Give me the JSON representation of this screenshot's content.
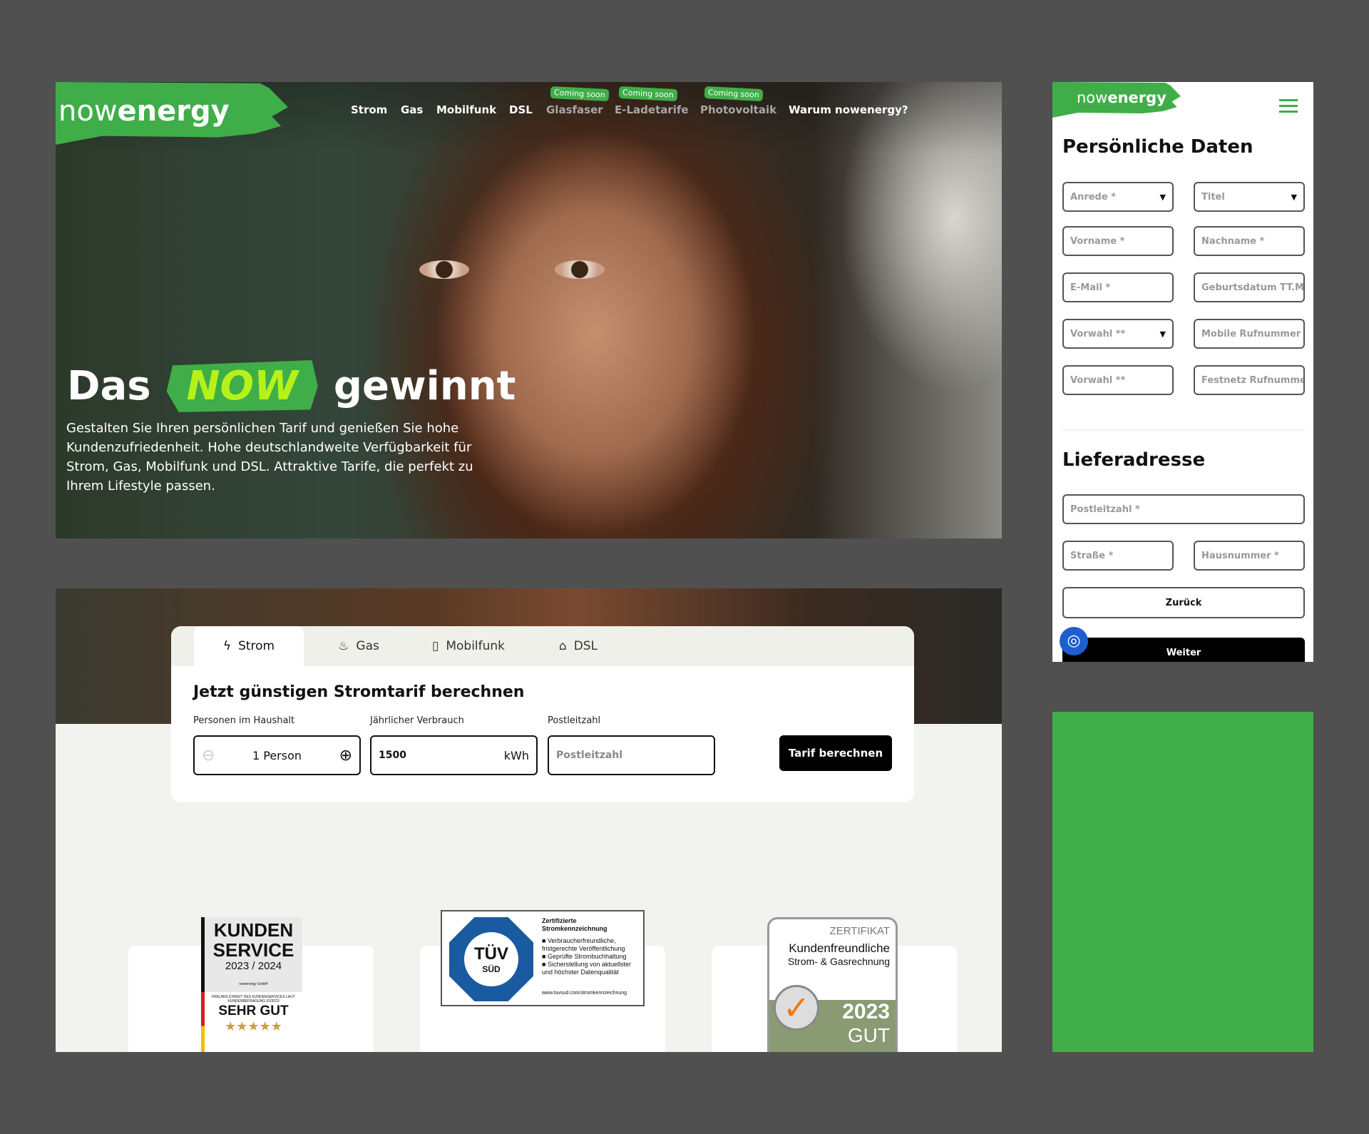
{
  "hero": {
    "logo": {
      "light": "now",
      "bold": "energy"
    },
    "nav": [
      {
        "label": "Strom"
      },
      {
        "label": "Gas"
      },
      {
        "label": "Mobilfunk"
      },
      {
        "label": "DSL"
      },
      {
        "label": "Glasfaser",
        "badge": "Coming soon"
      },
      {
        "label": "E-Ladetarife",
        "badge": "Coming soon"
      },
      {
        "label": "Photovoltaik",
        "badge": "Coming soon"
      },
      {
        "label": "Warum nowenergy?"
      }
    ],
    "headline": {
      "before": "Das",
      "highlight": "NOW",
      "after": "gewinnt"
    },
    "text": "Gestalten Sie Ihren persönlichen Tarif und genießen Sie hohe Kundenzufriedenheit. Hohe deutschlandweite Verfügbarkeit für Strom, Gas, Mobilfunk und DSL. Attraktive Tarife, die perfekt zu Ihrem Lifestyle passen."
  },
  "calculator": {
    "tabs": [
      {
        "label": "Strom",
        "icon": "bolt-icon"
      },
      {
        "label": "Gas",
        "icon": "flame-icon"
      },
      {
        "label": "Mobilfunk",
        "icon": "phone-icon"
      },
      {
        "label": "DSL",
        "icon": "router-icon"
      }
    ],
    "title": "Jetzt günstigen Stromtarif berechnen",
    "persons_label": "Personen im Haushalt",
    "persons_value": "1 Person",
    "usage_label": "Jährlicher Verbrauch",
    "usage_value": "1500",
    "usage_unit": "kWh",
    "zip_label": "Postleitzahl",
    "zip_placeholder": "Postleitzahl",
    "submit": "Tarif berechnen"
  },
  "badges": {
    "kunden": {
      "l1": "KUNDEN",
      "l2": "SERVICE",
      "years": "2023 / 2024",
      "company": "nowenergy GmbH",
      "small": "FREUNDLICHKEIT DES KUNDENSERVICES LAUT KUNDENBEFRAGUNG 02/2023",
      "rating": "SEHR GUT",
      "stars": "★★★★★"
    },
    "tuv": {
      "logo": "TÜV",
      "sub": "SÜD",
      "title": "Zertifizierte Stromkennzeichnung",
      "items": [
        "Verbraucherfreundliche, fristgerechte Veröffentlichung",
        "Geprüfte Strombuchhaltung",
        "Sicherstellung von aktuellster und höchster Datenqualität"
      ],
      "url": "www.tuvsud.com/stromkennzeichnung"
    },
    "zert": {
      "head": "ZERTIFIKAT",
      "l1": "Kundenfreundliche",
      "l2": "Strom- & Gasrechnung",
      "year": "2023",
      "rating": "GUT"
    }
  },
  "mobile": {
    "logo": {
      "light": "now",
      "bold": "energy"
    },
    "section1": "Persönliche Daten",
    "fields1": [
      "Anrede *",
      "Titel",
      "Vorname *",
      "Nachname *",
      "E-Mail *",
      "Geburtsdatum TT.MM.JJJJ *",
      "Vorwahl **",
      "Mobile Rufnummer *",
      "Vorwahl **",
      "Festnetz Rufnummer"
    ],
    "section2": "Lieferadresse",
    "fields2": [
      "Postleitzahl *",
      "Straße *",
      "Hausnummer *"
    ],
    "back": "Zurück",
    "next": "Weiter"
  },
  "colors": {
    "brand": "#3fae49",
    "now_text": "#b6f21a"
  }
}
